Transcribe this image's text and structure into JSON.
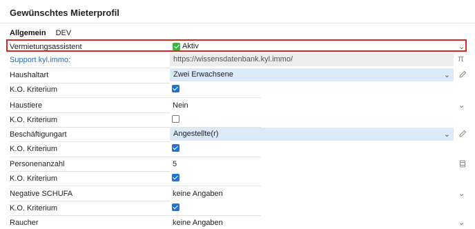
{
  "card": {
    "title": "Gewünschtes Mieterprofil"
  },
  "tabs": {
    "general": "Allgemein",
    "dev": "DEV"
  },
  "rows": {
    "assistant": {
      "label": "Vermietungsassistent",
      "value": "Aktiv"
    },
    "support": {
      "label": "Support kyl.immo:",
      "value": "https://wissensdatenbank.kyl.immo/"
    },
    "household": {
      "label": "Haushaltart",
      "value": "Zwei Erwachsene",
      "ko_label": "K.O. Kriterium",
      "ko_checked": true
    },
    "pets": {
      "label": "Haustiere",
      "value": "Nein",
      "ko_label": "K.O. Kriterium",
      "ko_checked": false
    },
    "employment": {
      "label": "Beschäftigungart",
      "value": "Angestellte(r)",
      "ko_label": "K.O. Kriterium",
      "ko_checked": true
    },
    "persons": {
      "label": "Personenanzahl",
      "value": "5",
      "ko_label": "K.O. Kriterium",
      "ko_checked": true
    },
    "schufa": {
      "label": "Negative SCHUFA",
      "value": "keine Angaben",
      "ko_label": "K.O. Kriterium",
      "ko_checked": true
    },
    "smoker": {
      "label": "Raucher",
      "value": "keine Angaben"
    }
  },
  "icons": {
    "chevron": "chevron-down-icon",
    "pi": "π",
    "pencil": "pencil-icon",
    "trash": "trash-icon",
    "status": "green-check-icon"
  },
  "colors": {
    "highlight": "#e2231a",
    "link": "#2c6db3",
    "select_bg": "#dce9f6",
    "checkbox": "#1f73d8",
    "status_green": "#3fb24a"
  }
}
